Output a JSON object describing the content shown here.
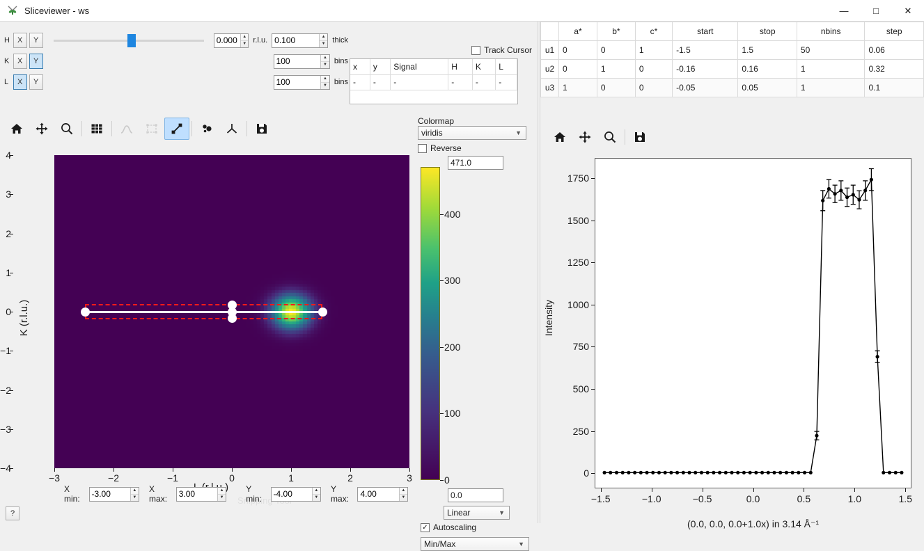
{
  "window": {
    "title": "Sliceviewer - ws",
    "app_icon": "mantid-icon",
    "minimize": "—",
    "maximize": "□",
    "close": "✕"
  },
  "axis_controls": {
    "rows": [
      {
        "name": "H",
        "x_label": "X",
        "y_label": "Y",
        "x_selected": false,
        "y_selected": false,
        "has_slider": true,
        "slider_value": "0.000",
        "unit": "r.l.u.",
        "field_value": "0.100",
        "field_suffix": "thick"
      },
      {
        "name": "K",
        "x_label": "X",
        "y_label": "Y",
        "x_selected": false,
        "y_selected": true,
        "has_slider": false,
        "slider_value": "",
        "unit": "",
        "field_value": "100",
        "field_suffix": "bins"
      },
      {
        "name": "L",
        "x_label": "X",
        "y_label": "Y",
        "x_selected": true,
        "y_selected": false,
        "has_slider": false,
        "slider_value": "",
        "unit": "",
        "field_value": "100",
        "field_suffix": "bins"
      }
    ]
  },
  "track_cursor": {
    "label": "Track Cursor",
    "checked": false
  },
  "cursor_table": {
    "headers": [
      "x",
      "y",
      "Signal",
      "H",
      "K",
      "L"
    ],
    "rows": [
      [
        "-",
        "-",
        "-",
        "-",
        "-",
        "-"
      ]
    ]
  },
  "toolbar_2d": {
    "buttons": [
      {
        "name": "home-icon",
        "label": "Home",
        "active": false,
        "enabled": true
      },
      {
        "name": "pan-icon",
        "label": "Pan",
        "active": false,
        "enabled": true
      },
      {
        "name": "zoom-icon",
        "label": "Zoom",
        "active": false,
        "enabled": true
      },
      {
        "name": "grid-icon",
        "label": "Grid",
        "active": false,
        "enabled": true
      },
      {
        "name": "peak-overlay-icon",
        "label": "Peak Overlay",
        "active": false,
        "enabled": false
      },
      {
        "name": "region-select-icon",
        "label": "Region",
        "active": false,
        "enabled": false
      },
      {
        "name": "line-cut-icon",
        "label": "Line Cut",
        "active": true,
        "enabled": true
      },
      {
        "name": "non-orthogonal-icon",
        "label": "Non-Orthogonal",
        "active": false,
        "enabled": true
      },
      {
        "name": "nonaxis-icon",
        "label": "Axes",
        "active": false,
        "enabled": true
      },
      {
        "name": "save-icon",
        "label": "Save",
        "active": false,
        "enabled": true
      }
    ]
  },
  "colormap": {
    "label": "Colormap",
    "value": "viridis",
    "reverse_label": "Reverse",
    "reverse_checked": false,
    "max_value": "471.0",
    "min_value": "0.0",
    "scale_value": "Linear",
    "autoscaling_label": "Autoscaling",
    "autoscaling_checked": true,
    "normalization": "Min/Max"
  },
  "limits": {
    "x_min_label": "X min:",
    "x_min": "-3.00",
    "x_max_label": "X max:",
    "x_max": "3.00",
    "y_min_label": "Y min:",
    "y_min": "-4.00",
    "y_max_label": "Y max:",
    "y_max": "4.00",
    "help": "?"
  },
  "projection_table": {
    "headers": [
      "",
      "a*",
      "b*",
      "c*",
      "start",
      "stop",
      "nbins",
      "step"
    ],
    "rows": [
      {
        "name": "u1",
        "a": "0",
        "b": "0",
        "c": "1",
        "start": "-1.5",
        "stop": "1.5",
        "nbins": "50",
        "step": "0.06"
      },
      {
        "name": "u2",
        "a": "0",
        "b": "1",
        "c": "0",
        "start": "-0.16",
        "stop": "0.16",
        "nbins": "1",
        "step": "0.32"
      },
      {
        "name": "u3",
        "a": "1",
        "b": "0",
        "c": "0",
        "start": "-0.05",
        "stop": "0.05",
        "nbins": "1",
        "step": "0.1"
      }
    ]
  },
  "toolbar_1d": {
    "buttons": [
      {
        "name": "home-icon",
        "label": "Home"
      },
      {
        "name": "pan-icon",
        "label": "Pan"
      },
      {
        "name": "zoom-icon",
        "label": "Zoom"
      },
      {
        "name": "save-icon",
        "label": "Save"
      }
    ]
  },
  "watermark": {
    "text": "Snipping Tool"
  },
  "chart_data": [
    {
      "id": "slice-2d",
      "type": "heatmap",
      "title": "",
      "xlabel": "L (r.l.u.)",
      "ylabel": "K (r.l.u.)",
      "xlim": [
        -3,
        3
      ],
      "ylim": [
        -4,
        4
      ],
      "xticks": [
        -3,
        -2,
        -1,
        0,
        1,
        2,
        3
      ],
      "yticks": [
        -4,
        -3,
        -2,
        -1,
        0,
        1,
        2,
        3,
        4
      ],
      "colormap": "viridis",
      "colorbar": {
        "min": 0,
        "max": 471,
        "ticks": [
          0,
          100,
          200,
          300,
          400
        ]
      },
      "background_value": 0,
      "blobs": [
        {
          "cx": 1.0,
          "cy": 0.0,
          "rx": 0.32,
          "ry": 0.42,
          "peak": 471
        }
      ],
      "cut_overlay": {
        "start": [
          -2.48,
          0.0
        ],
        "end": [
          1.53,
          0.0
        ],
        "thickness_rlu": 0.32,
        "line_color": "#ffffff",
        "box_color": "#f51a1a",
        "handles": [
          [
            -2.48,
            0.0
          ],
          [
            0.0,
            0.0
          ],
          [
            1.53,
            0.0
          ],
          [
            0.0,
            0.17
          ],
          [
            0.0,
            -0.17
          ]
        ]
      }
    },
    {
      "id": "line-cut",
      "type": "line",
      "title": "",
      "xlabel": "(0.0, 0.0, 0.0+1.0x) in 3.14 Å⁻¹",
      "ylabel": "Intensity",
      "xlim": [
        -1.56,
        1.56
      ],
      "ylim": [
        -90,
        1870
      ],
      "xticks": [
        -1.5,
        -1.0,
        -0.5,
        0.0,
        0.5,
        1.0,
        1.5
      ],
      "yticks": [
        0,
        250,
        500,
        750,
        1000,
        1250,
        1500,
        1750
      ],
      "marker": "o",
      "color": "#000000",
      "errorbars": true,
      "x": [
        -1.47,
        -1.41,
        -1.35,
        -1.29,
        -1.23,
        -1.17,
        -1.11,
        -1.05,
        -0.99,
        -0.93,
        -0.87,
        -0.81,
        -0.75,
        -0.69,
        -0.63,
        -0.57,
        -0.51,
        -0.45,
        -0.39,
        -0.33,
        -0.27,
        -0.21,
        -0.15,
        -0.09,
        -0.03,
        0.03,
        0.09,
        0.15,
        0.21,
        0.27,
        0.33,
        0.39,
        0.45,
        0.51,
        0.57,
        0.63,
        0.69,
        0.75,
        0.81,
        0.87,
        0.93,
        0.99,
        1.05,
        1.11,
        1.17,
        1.23,
        1.29,
        1.35,
        1.41,
        1.47
      ],
      "y": [
        0,
        0,
        0,
        0,
        0,
        0,
        0,
        0,
        0,
        0,
        0,
        0,
        0,
        0,
        0,
        0,
        0,
        0,
        0,
        0,
        0,
        0,
        0,
        0,
        0,
        0,
        0,
        0,
        0,
        0,
        0,
        0,
        0,
        0,
        0,
        220,
        1620,
        1690,
        1660,
        1680,
        1640,
        1655,
        1625,
        1680,
        1745,
        690,
        0,
        0,
        0,
        0
      ],
      "yerr": [
        0,
        0,
        0,
        0,
        0,
        0,
        0,
        0,
        0,
        0,
        0,
        0,
        0,
        0,
        0,
        0,
        0,
        0,
        0,
        0,
        0,
        0,
        0,
        0,
        0,
        0,
        0,
        0,
        0,
        0,
        0,
        0,
        0,
        0,
        0,
        25,
        60,
        55,
        52,
        58,
        55,
        57,
        54,
        58,
        65,
        35,
        0,
        0,
        0,
        0
      ]
    }
  ]
}
